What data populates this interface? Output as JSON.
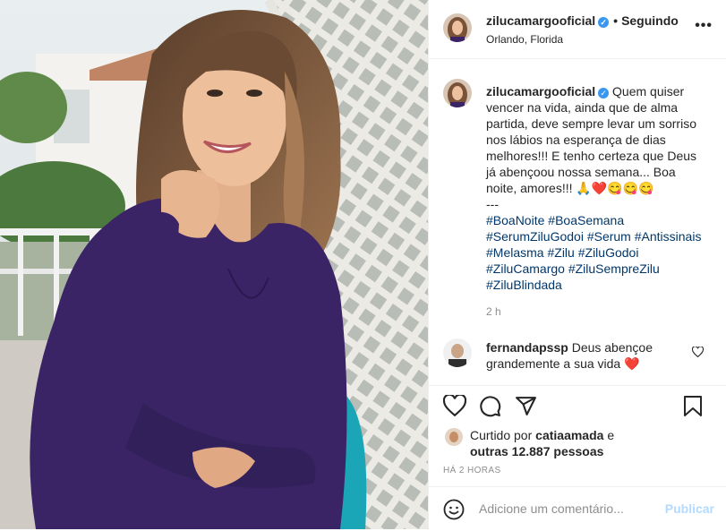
{
  "post": {
    "username": "zilucamargooficial",
    "follow_status": "Seguindo",
    "location": "Orlando, Florida",
    "more_label": "•••"
  },
  "caption": {
    "username": "zilucamargooficial",
    "text": "Quem quiser vencer na vida, ainda que de alma partida, deve sempre levar um sorriso nos lábios na esperança de dias melhores!!! E tenho certeza que Deus já abençoou nossa semana... Boa noite, amores!!! 🙏❤️😋😋😋",
    "separator": "---",
    "hashtags": [
      "#BoaNoite",
      "#BoaSemana",
      "#SerumZiluGodoi",
      "#Serum",
      "#Antissinais",
      "#Melasma",
      "#Zilu",
      "#ZiluGodoi",
      "#ZiluCamargo",
      "#ZiluSempreZilu",
      "#ZiluBlindada"
    ],
    "time": "2 h"
  },
  "comment": {
    "username": "fernandapssp",
    "text": "Deus abençoe grandemente a sua vida ❤️"
  },
  "likes": {
    "prefix": "Curtido por",
    "user": "catiaamada",
    "connector": "e",
    "others": "outras 12.887 pessoas"
  },
  "timestamp": "HÁ 2 HORAS",
  "add_comment": {
    "placeholder": "Adicione um comentário...",
    "publish_label": "Publicar"
  },
  "icons": [
    "heart-icon",
    "comment-icon",
    "share-icon",
    "bookmark-icon",
    "emoji-icon",
    "verified-icon",
    "more-icon"
  ],
  "colors": {
    "link": "#00376b",
    "verified": "#3897f0",
    "publish_disabled": "#b3dbff",
    "secondary_text": "#8e8e8e",
    "dress": "#3b2466"
  }
}
